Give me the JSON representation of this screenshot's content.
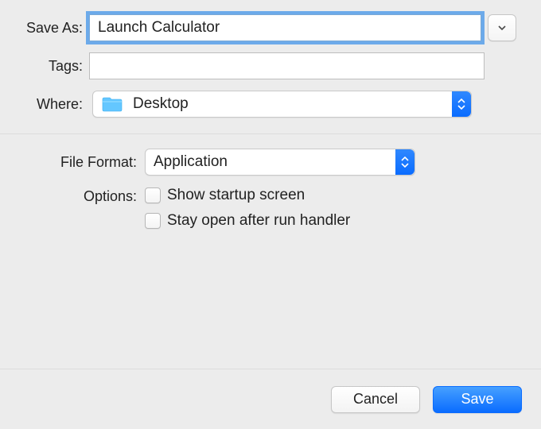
{
  "labels": {
    "save_as": "Save As:",
    "tags": "Tags:",
    "where": "Where:",
    "file_format": "File Format:",
    "options": "Options:"
  },
  "fields": {
    "save_as_value": "Launch Calculator",
    "tags_value": "",
    "where_value": "Desktop",
    "file_format_value": "Application"
  },
  "options": {
    "show_startup": "Show startup screen",
    "stay_open": "Stay open after run handler"
  },
  "buttons": {
    "cancel": "Cancel",
    "save": "Save"
  },
  "colors": {
    "accent": "#0a6cff",
    "focus_ring": "#5ea3ea"
  }
}
